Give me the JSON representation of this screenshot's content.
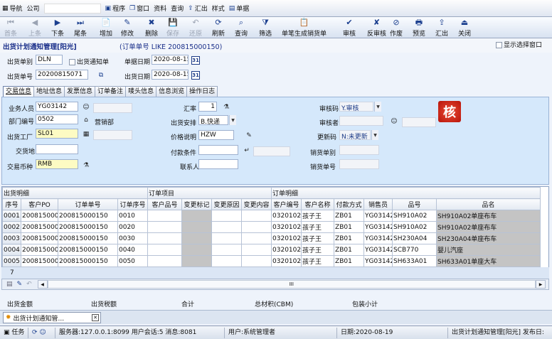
{
  "menubar": {
    "nav": "导航",
    "company": "公司",
    "program": "程序",
    "window": "窗口",
    "data": "资料",
    "query": "查询",
    "summary": "汇出",
    "style": "样式",
    "single": "单据"
  },
  "toolbar": [
    {
      "name": "first",
      "label": "首条",
      "icon": "⏮",
      "disabled": true
    },
    {
      "name": "prev",
      "label": "上条",
      "icon": "◀",
      "disabled": true
    },
    {
      "name": "next",
      "label": "下条",
      "icon": "▶",
      "disabled": false
    },
    {
      "name": "last",
      "label": "尾条",
      "icon": "⏭",
      "disabled": false
    },
    {
      "name": "add",
      "label": "增加",
      "icon": "📄",
      "disabled": false
    },
    {
      "name": "edit",
      "label": "修改",
      "icon": "✎",
      "disabled": false
    },
    {
      "name": "delete",
      "label": "删除",
      "icon": "✖",
      "disabled": false
    },
    {
      "name": "save",
      "label": "保存",
      "icon": "💾",
      "disabled": true
    },
    {
      "name": "restore",
      "label": "还原",
      "icon": "↶",
      "disabled": true
    },
    {
      "name": "refresh",
      "label": "刷新",
      "icon": "⟳",
      "disabled": false
    },
    {
      "name": "query",
      "label": "查询",
      "icon": "⌕",
      "disabled": false
    },
    {
      "name": "filter",
      "label": "筛选",
      "icon": "⧩",
      "disabled": false
    },
    {
      "name": "gen-cancel",
      "label": "单笔生成销货单",
      "icon": "📋",
      "disabled": false
    },
    {
      "name": "audit",
      "label": "审核",
      "icon": "✔",
      "disabled": false
    },
    {
      "name": "unaudit",
      "label": "反审核",
      "icon": "✘",
      "disabled": false
    },
    {
      "name": "void",
      "label": "作废",
      "icon": "⊘",
      "disabled": false
    },
    {
      "name": "preview",
      "label": "预览",
      "icon": "🖶",
      "disabled": false
    },
    {
      "name": "export",
      "label": "汇出",
      "icon": "⇪",
      "disabled": false
    },
    {
      "name": "close",
      "label": "关闭",
      "icon": "⏏",
      "disabled": false
    }
  ],
  "header": {
    "title": "出货计划通知管理[阳光]",
    "filter": "(订单单号 LIKE 200815000150)",
    "show_select_window": "显示选择窗口"
  },
  "top_form": {
    "type_label": "出货单别",
    "type_value": "DLN",
    "notice_label": "出货通知单",
    "bill_date_label": "单据日期",
    "bill_date_value": "2020-08-15",
    "no_label": "出货单号",
    "no_value": "20200815071",
    "ship_date_label": "出货日期",
    "ship_date_value": "2020-08-15",
    "cal_text": "31"
  },
  "tabs": [
    "交易信息",
    "地址信息",
    "发票信息",
    "订单备注",
    "唛头信息",
    "信息浏览",
    "操作日志"
  ],
  "form": {
    "salesman_label": "业务人员",
    "salesman_value": "YG03142",
    "rate_label": "汇率",
    "rate_value": "1",
    "audit_code_label": "审核码",
    "audit_code_value": "Y.审核",
    "dept_label": "部门编号",
    "dept_value": "0502",
    "dept_name": "营销部",
    "ship_arrange_label": "出货安排",
    "ship_arrange_value": "B.快递",
    "auditor_label": "审核者",
    "factory_label": "出货工厂",
    "factory_value": "SL01",
    "price_label": "价格说明",
    "price_value": "HZW",
    "update_code_label": "更新码",
    "update_code_value": "N:未更新",
    "delivery_label": "交货地",
    "pay_label": "付款条件",
    "sales_type_label": "销货单别",
    "currency_label": "交易币种",
    "currency_value": "RMB",
    "contact_label": "联系人",
    "sales_no_label": "销货单号",
    "audit_stamp": "核"
  },
  "grid": {
    "group1": "出货明细",
    "group2": "订单项目",
    "group3": "订单明细",
    "columns": [
      "序号",
      "客户PO",
      "订单单号",
      "订单序号",
      "客户品号",
      "变更标记",
      "变更原因",
      "变更内容",
      "客户编号",
      "客户名称",
      "付款方式",
      "销售员",
      "品号",
      "品名"
    ],
    "rows": [
      [
        "0001",
        "200815000",
        "200815000150",
        "0010",
        "",
        "",
        "",
        "",
        "03201025",
        "孩子王",
        "ZB01",
        "YG03142",
        "SH910A02",
        "SH910A02单座布车"
      ],
      [
        "0002",
        "200815000",
        "200815000150",
        "0020",
        "",
        "",
        "",
        "",
        "03201025",
        "孩子王",
        "ZB01",
        "YG03142",
        "SH910A02",
        "SH910A02单座布车"
      ],
      [
        "0003",
        "200815000",
        "200815000150",
        "0030",
        "",
        "",
        "",
        "",
        "03201025",
        "孩子王",
        "ZB01",
        "YG03142",
        "SH230A04",
        "SH230A04单座布车"
      ],
      [
        "0004",
        "200815000",
        "200815000150",
        "0040",
        "",
        "",
        "",
        "",
        "03201025",
        "孩子王",
        "ZB01",
        "YG03142",
        "SCB770",
        "婴儿汽座"
      ],
      [
        "0005",
        "200815000",
        "200815000150",
        "0050",
        "",
        "",
        "",
        "",
        "03201025",
        "孩子王",
        "ZB01",
        "YG03142",
        "SH633A01",
        "SH633A01单座大车"
      ]
    ],
    "count": "7"
  },
  "pager": {
    "scroll_label": "III"
  },
  "summary": {
    "amount": "出货金额",
    "tax": "出货税额",
    "total": "合计",
    "volume": "总材积(CBM)",
    "packages": "包装小计"
  },
  "taskbar": {
    "tab_label": "出货计划通知管..."
  },
  "status": {
    "task": "任务",
    "server": "服务器:127.0.0.1:8099 用户会话:5 消息:8081",
    "user": "用户:系统管理者",
    "date": "日期:2020-08-19",
    "window": "出货计划通知管理[阳光] 发布日:"
  },
  "colors": {
    "accent": "#1a2f8a",
    "panel": "#d5e8fb",
    "required": "#fdfbc3",
    "stamp": "#d42a1e"
  }
}
